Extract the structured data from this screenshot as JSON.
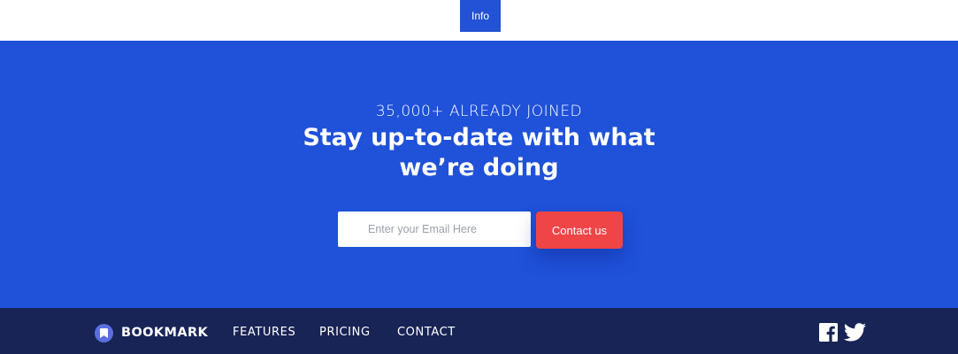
{
  "top_bar": {
    "info_label": "Info"
  },
  "hero": {
    "eyebrow": "35,000+ ALREADY JOINED",
    "headline": "Stay up-to-date with what we’re doing",
    "email_placeholder": "Enter your Email Here",
    "cta_label": "Contact us"
  },
  "footer": {
    "brand": "BOOKMARK",
    "nav": [
      "FEATURES",
      "PRICING",
      "CONTACT"
    ],
    "social_icons": [
      "facebook-icon",
      "twitter-icon"
    ]
  },
  "colors": {
    "hero_background": "#1f51d9",
    "info_tab": "#2452d6",
    "cta_button": "#f04547",
    "footer_background": "#182456",
    "logo_accent": "#5a6fe0"
  }
}
